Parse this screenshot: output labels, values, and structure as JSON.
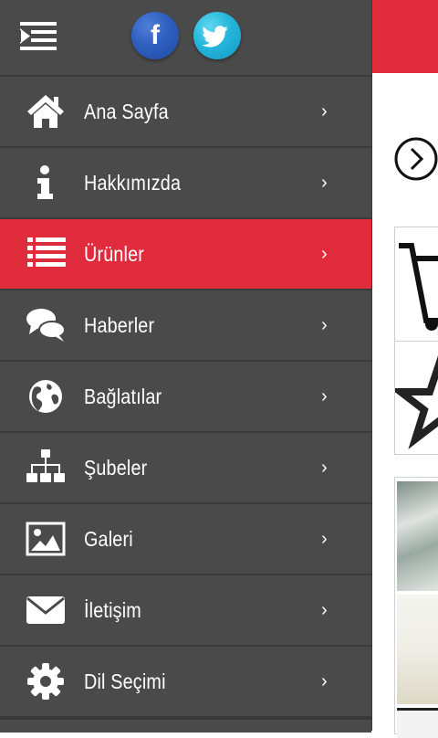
{
  "social": {
    "facebook_glyph": "f",
    "twitter_glyph": "t"
  },
  "menu": {
    "items": [
      {
        "label": "Ana Sayfa",
        "icon": "home-icon"
      },
      {
        "label": "Hakkımızda",
        "icon": "info-icon"
      },
      {
        "label": "Ürünler",
        "icon": "list-icon",
        "active": true
      },
      {
        "label": "Haberler",
        "icon": "chat-icon"
      },
      {
        "label": "Bağlatılar",
        "icon": "globe-icon"
      },
      {
        "label": "Şubeler",
        "icon": "sitemap-icon"
      },
      {
        "label": "Galeri",
        "icon": "image-icon"
      },
      {
        "label": "İletişim",
        "icon": "envelope-icon"
      },
      {
        "label": "Dil Seçimi",
        "icon": "gear-icon"
      }
    ],
    "chevron": "›"
  },
  "colors": {
    "accent": "#e02b3c",
    "drawer": "#4a4a4a",
    "divider": "#3a3a3a"
  }
}
